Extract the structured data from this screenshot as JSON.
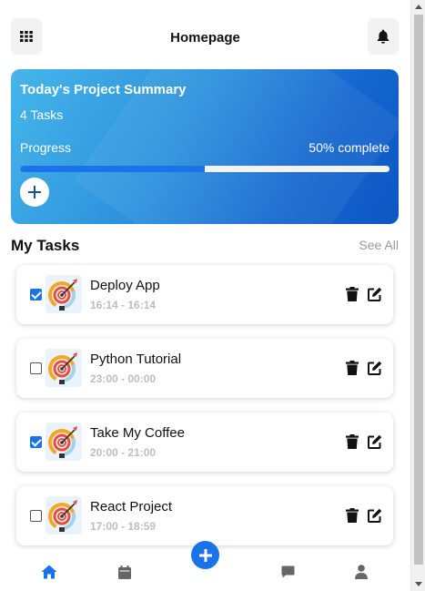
{
  "header": {
    "title": "Homepage",
    "menu_icon": "grid-menu-icon",
    "notification_icon": "bell-icon"
  },
  "summary": {
    "title": "Today's Project Summary",
    "task_count": "4 Tasks",
    "progress_label": "Progress",
    "progress_value": "50% complete",
    "progress_fraction": 0.5,
    "add_icon": "plus-icon"
  },
  "tasks_section": {
    "heading": "My Tasks",
    "see_all": "See All"
  },
  "tasks": [
    {
      "name": "Deploy App",
      "time": "16:14 - 16:14",
      "checked": true
    },
    {
      "name": "Python Tutorial",
      "time": "23:00 - 00:00",
      "checked": false
    },
    {
      "name": "Take My Coffee",
      "time": "20:00 - 21:00",
      "checked": true
    },
    {
      "name": "React Project",
      "time": "17:00 - 18:59",
      "checked": false
    }
  ],
  "bottom_nav": {
    "items": [
      "home-icon",
      "calendar-icon",
      "add-icon",
      "chat-icon",
      "user-icon"
    ],
    "active": "home-icon"
  },
  "colors": {
    "accent": "#1a73e8",
    "card_gradient_start": "#46b6ea",
    "card_gradient_end": "#0e56c4",
    "muted_text": "#999999"
  }
}
